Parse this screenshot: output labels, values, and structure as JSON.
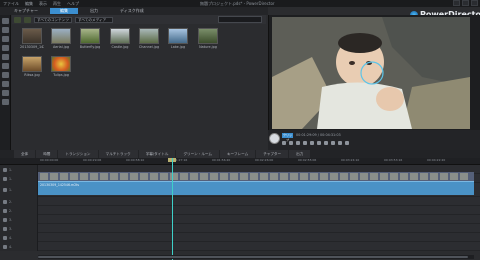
{
  "app": {
    "title": "無題プロジェクト.pds* - PowerDirector",
    "menu": [
      "ファイル",
      "編集",
      "表示",
      "再生",
      "ヘルプ"
    ],
    "brand": "PowerDirector"
  },
  "main_tabs": [
    {
      "label": "キャプチャー",
      "active": false
    },
    {
      "label": "編集",
      "active": true
    },
    {
      "label": "出力",
      "active": false
    },
    {
      "label": "ディスク作成",
      "active": false
    }
  ],
  "library": {
    "filter_dropdown": "すべてのコンテンツ",
    "sort_dropdown": "すべてのメディア",
    "items": [
      {
        "label": "20130309_142546"
      },
      {
        "label": "Aerial.jpg"
      },
      {
        "label": "Butterfly.jpg"
      },
      {
        "label": "Castle.jpg"
      },
      {
        "label": "Channel.jpg"
      },
      {
        "label": "Lake.jpg"
      },
      {
        "label": "Nature.jpg"
      },
      {
        "label": "Riksa.jpg"
      },
      {
        "label": "Tulips.jpg"
      }
    ]
  },
  "preview": {
    "mode_label": "クリップ",
    "timecode": "00:01:29:09 / 00:04:31:03"
  },
  "timeline": {
    "tabs": [
      "全体",
      "時間",
      "トランジション",
      "マルチトラック",
      "字幕/タイトル",
      "グリーン・ルーム",
      "キーフレーム",
      "チャプター",
      "出力"
    ],
    "ruler": [
      "00:00:00:00",
      "00:00:29:06",
      "00:00:58:10",
      "00:01:27:16",
      "00:01:56:20",
      "00:02:26:00",
      "00:02:55:06",
      "00:03:24:10",
      "00:03:53:16",
      "00:04:22:20"
    ],
    "clip_label": "20130309_142546.m2ts",
    "tracks": [
      "1.",
      "1.",
      "1.",
      "2.",
      "2.",
      "3.",
      "3.",
      "4.",
      "4.",
      "5.",
      "5.",
      "6.",
      "6."
    ]
  }
}
